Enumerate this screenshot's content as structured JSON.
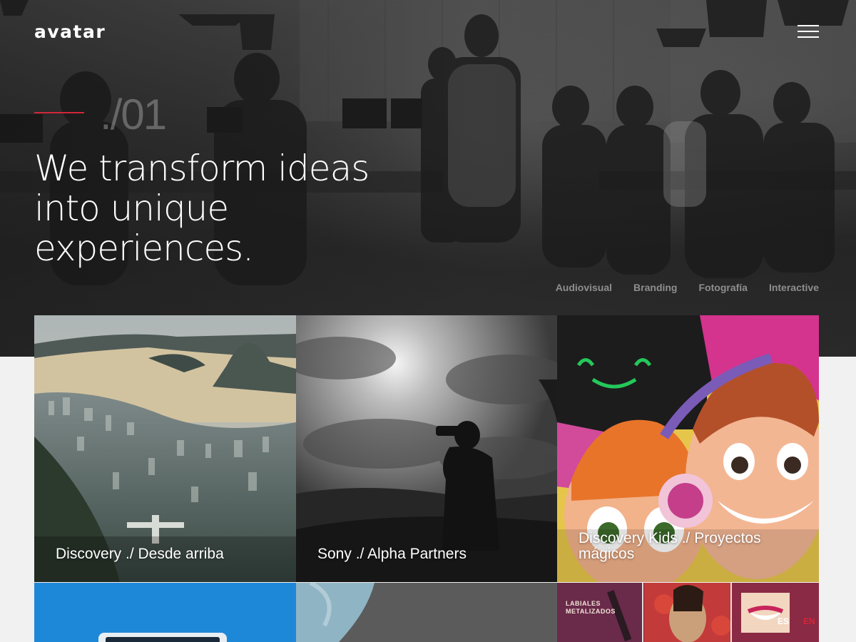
{
  "header": {
    "logo_text": "avatar",
    "menu_icon": "hamburger-menu-icon"
  },
  "hero": {
    "slide_number": "./01",
    "headline_lines": [
      "We transform ideas",
      "into unique",
      "experiences."
    ],
    "accent_color": "#d3263a"
  },
  "categories": [
    {
      "label": "Audiovisual"
    },
    {
      "label": "Branding"
    },
    {
      "label": "Fotografía"
    },
    {
      "label": "Interactive"
    }
  ],
  "projects": [
    {
      "title": "Discovery ./ Desde arriba"
    },
    {
      "title": "Sony ./ Alpha Partners"
    },
    {
      "title": "Discovery Kids ./ Proyectos mágicos"
    },
    {
      "title": ""
    },
    {
      "title": ""
    },
    {
      "title": "",
      "overlay_text": "LABIALES\nMETALIZADOS"
    }
  ],
  "language": {
    "es": "ES",
    "en": "EN"
  }
}
